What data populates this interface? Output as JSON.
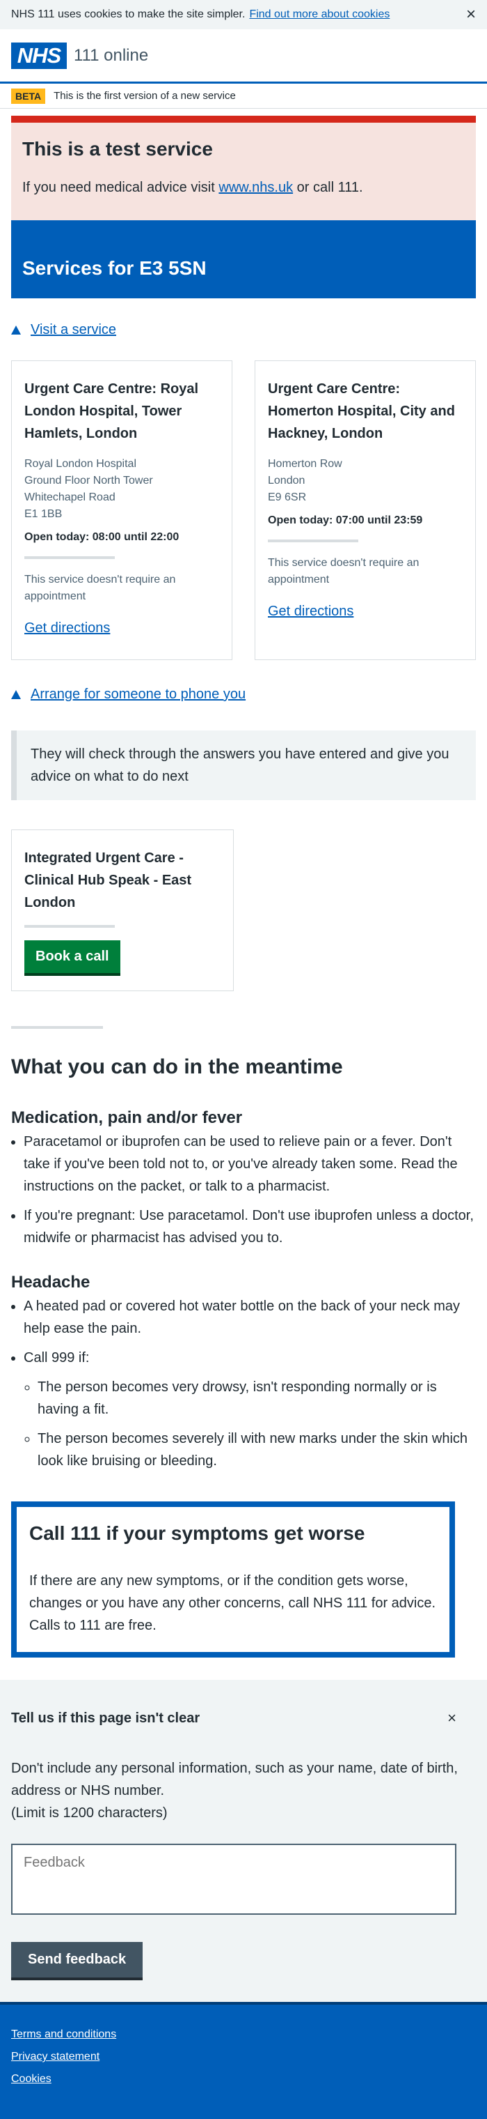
{
  "cookie": {
    "text": "NHS 111 uses cookies to make the site simpler.",
    "link": "Find out more about cookies",
    "close": "×"
  },
  "header": {
    "logo": "NHS",
    "service": "111 online"
  },
  "beta": {
    "tag": "BETA",
    "text": "This is the first version of a new service"
  },
  "test_service": {
    "title": "This is a test service",
    "text_before": "If you need medical advice visit",
    "link": "www.nhs.uk",
    "text_after": "or call 111."
  },
  "page_title": "Services for E3 5SN",
  "visit": {
    "label": "Visit a service"
  },
  "services": [
    {
      "title": "Urgent Care Centre: Royal London Hospital, Tower Hamlets, London",
      "address": [
        "Royal London Hospital",
        "Ground Floor North Tower",
        "Whitechapel Road",
        "E1 1BB"
      ],
      "hours": "Open today: 08:00 until 22:00",
      "note": "This service doesn't require an appointment",
      "link": "Get directions"
    },
    {
      "title": "Urgent Care Centre: Homerton Hospital, City and Hackney, London",
      "address": [
        "Homerton Row",
        "London",
        "E9 6SR"
      ],
      "hours": "Open today: 07:00 until 23:59",
      "note": "This service doesn't require an appointment",
      "link": "Get directions"
    }
  ],
  "arrange": {
    "label": "Arrange for someone to phone you",
    "inset": "They will check through the answers you have entered and give you advice on what to do next",
    "card_title": "Integrated Urgent Care - Clinical Hub Speak - East London",
    "button": "Book a call"
  },
  "meantime": {
    "title": "What you can do in the meantime",
    "medication": {
      "title": "Medication, pain and/or fever",
      "items": [
        "Paracetamol or ibuprofen can be used to relieve pain or a fever. Don't take if you've been told not to, or you've already taken some. Read the instructions on the packet, or talk to a pharmacist.",
        "If you're pregnant: Use paracetamol. Don't use ibuprofen unless a doctor, midwife or pharmacist has advised you to."
      ]
    },
    "headache": {
      "title": "Headache",
      "item1": "A heated pad or covered hot water bottle on the back of your neck may help ease the pain.",
      "item2": "Call 999 if:",
      "sub": [
        "The person becomes very drowsy, isn't responding normally or is having a fit.",
        "The person becomes severely ill with new marks under the skin which look like bruising or bleeding."
      ]
    }
  },
  "worse": {
    "title": "Call 111 if your symptoms get worse",
    "text": "If there are any new symptoms, or if the condition gets worse, changes or you have any other concerns, call NHS 111 for advice. Calls to 111 are free."
  },
  "feedback": {
    "title": "Tell us if this page isn't clear",
    "close": "×",
    "hint": "Don't include any personal information, such as your name, date of birth, address or NHS number.",
    "limit": "(Limit is 1200 characters)",
    "placeholder": "Feedback",
    "button": "Send feedback"
  },
  "footer": {
    "links": [
      "Terms and conditions",
      "Privacy statement",
      "Cookies"
    ]
  }
}
